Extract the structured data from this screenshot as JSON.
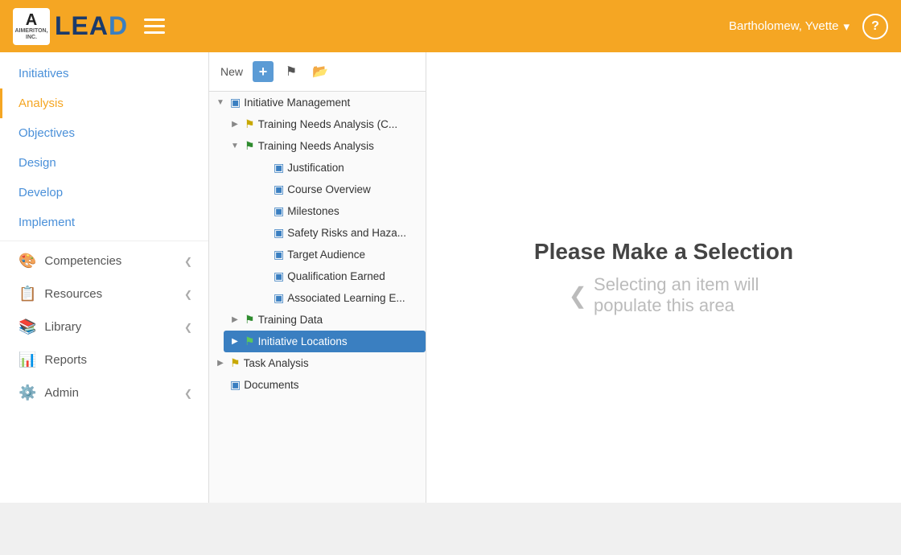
{
  "header": {
    "logo_subtext": "AIMERITON, INC.",
    "logo_a": "A",
    "logo_brand": "LEAD",
    "hamburger_label": "menu",
    "user_name": "Bartholomew, Yvette",
    "user_arrow": "▾",
    "help_label": "?"
  },
  "sidebar": {
    "items": [
      {
        "id": "initiatives",
        "label": "Initiatives",
        "icon": "",
        "hasArrow": false,
        "active": false,
        "isLink": true
      },
      {
        "id": "analysis",
        "label": "Analysis",
        "icon": "",
        "hasArrow": false,
        "active": true,
        "isLink": true
      },
      {
        "id": "objectives",
        "label": "Objectives",
        "icon": "",
        "hasArrow": false,
        "active": false,
        "isLink": true
      },
      {
        "id": "design",
        "label": "Design",
        "icon": "",
        "hasArrow": false,
        "active": false,
        "isLink": true
      },
      {
        "id": "develop",
        "label": "Develop",
        "icon": "",
        "hasArrow": false,
        "active": false,
        "isLink": true
      },
      {
        "id": "implement",
        "label": "Implement",
        "icon": "",
        "hasArrow": false,
        "active": false,
        "isLink": true
      },
      {
        "id": "competencies",
        "label": "Competencies",
        "icon": "🎨",
        "hasArrow": true,
        "active": false,
        "isLink": false
      },
      {
        "id": "resources",
        "label": "Resources",
        "icon": "📋",
        "hasArrow": true,
        "active": false,
        "isLink": false
      },
      {
        "id": "library",
        "label": "Library",
        "icon": "📚",
        "hasArrow": true,
        "active": false,
        "isLink": false
      },
      {
        "id": "reports",
        "label": "Reports",
        "icon": "📊",
        "hasArrow": false,
        "active": false,
        "isLink": false
      },
      {
        "id": "admin",
        "label": "Admin",
        "icon": "⚙️",
        "hasArrow": true,
        "active": false,
        "isLink": false
      }
    ]
  },
  "toolbar": {
    "new_label": "New",
    "add_icon": "+",
    "flag_icon": "⚑",
    "folder_icon": "📂"
  },
  "tree": {
    "nodes": [
      {
        "id": "initiative-mgmt",
        "label": "Initiative Management",
        "icon": "doc",
        "iconColor": "blue",
        "level": 0,
        "expanded": true,
        "hasExpander": true,
        "selected": false
      },
      {
        "id": "tna-old",
        "label": "Training Needs Analysis (C...",
        "icon": "flag",
        "iconColor": "yellow",
        "level": 1,
        "expanded": false,
        "hasExpander": true,
        "selected": false
      },
      {
        "id": "tna-main",
        "label": "Training Needs Analysis",
        "icon": "flag",
        "iconColor": "green",
        "level": 1,
        "expanded": true,
        "hasExpander": true,
        "selected": false
      },
      {
        "id": "justification",
        "label": "Justification",
        "icon": "doc",
        "iconColor": "blue",
        "level": 2,
        "expanded": false,
        "hasExpander": false,
        "selected": false
      },
      {
        "id": "course-overview",
        "label": "Course Overview",
        "icon": "doc",
        "iconColor": "blue",
        "level": 2,
        "expanded": false,
        "hasExpander": false,
        "selected": false
      },
      {
        "id": "milestones",
        "label": "Milestones",
        "icon": "doc",
        "iconColor": "blue",
        "level": 2,
        "expanded": false,
        "hasExpander": false,
        "selected": false
      },
      {
        "id": "safety-risks",
        "label": "Safety Risks and Haza...",
        "icon": "doc",
        "iconColor": "blue",
        "level": 2,
        "expanded": false,
        "hasExpander": false,
        "selected": false
      },
      {
        "id": "target-audience",
        "label": "Target Audience",
        "icon": "doc",
        "iconColor": "blue",
        "level": 2,
        "expanded": false,
        "hasExpander": false,
        "selected": false
      },
      {
        "id": "qualification-earned",
        "label": "Qualification Earned",
        "icon": "doc",
        "iconColor": "blue",
        "level": 2,
        "expanded": false,
        "hasExpander": false,
        "selected": false
      },
      {
        "id": "associated-learning",
        "label": "Associated Learning E...",
        "icon": "doc",
        "iconColor": "blue",
        "level": 2,
        "expanded": false,
        "hasExpander": false,
        "selected": false
      },
      {
        "id": "training-data",
        "label": "Training Data",
        "icon": "flag",
        "iconColor": "green",
        "level": 1,
        "expanded": false,
        "hasExpander": true,
        "selected": false
      },
      {
        "id": "initiative-locations",
        "label": "Initiative Locations",
        "icon": "flag",
        "iconColor": "green",
        "level": 1,
        "expanded": false,
        "hasExpander": true,
        "selected": true
      },
      {
        "id": "task-analysis",
        "label": "Task Analysis",
        "icon": "flag",
        "iconColor": "yellow",
        "level": 0,
        "expanded": false,
        "hasExpander": true,
        "selected": false
      },
      {
        "id": "documents",
        "label": "Documents",
        "icon": "doc",
        "iconColor": "blue",
        "level": 0,
        "expanded": false,
        "hasExpander": false,
        "selected": false
      }
    ]
  },
  "main": {
    "title": "Please Make a Selection",
    "subtitle": "Selecting an item will",
    "subtitle2": "populate this area",
    "chevron": "❮"
  }
}
